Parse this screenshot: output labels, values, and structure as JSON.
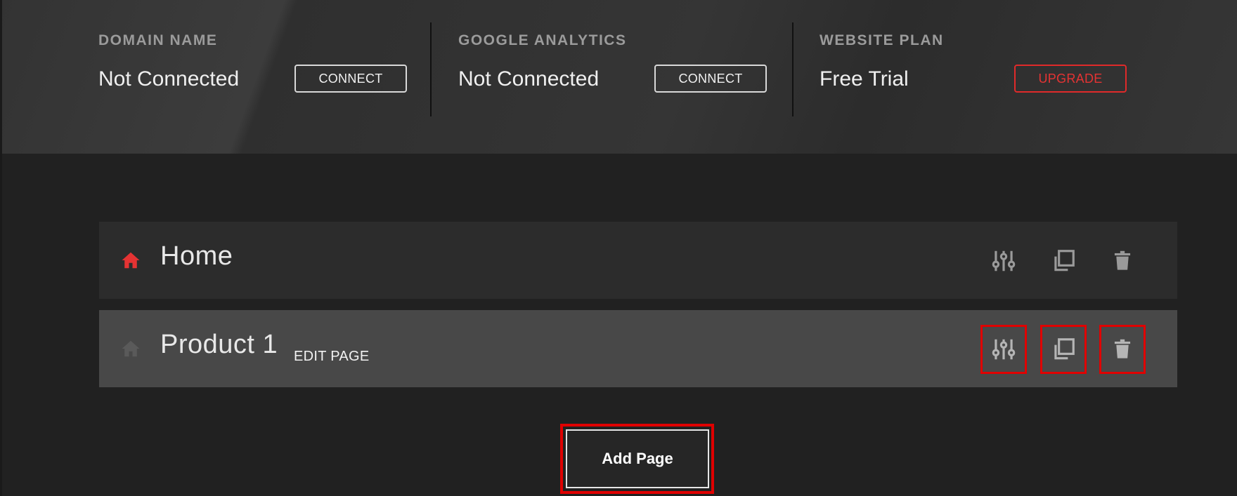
{
  "settings": {
    "domain": {
      "label": "DOMAIN NAME",
      "value": "Not Connected",
      "button": "CONNECT"
    },
    "analytics": {
      "label": "GOOGLE ANALYTICS",
      "value": "Not Connected",
      "button": "CONNECT"
    },
    "plan": {
      "label": "WEBSITE PLAN",
      "value": "Free Trial",
      "button": "UPGRADE"
    }
  },
  "pages": [
    {
      "title": "Home",
      "is_home": true,
      "edit_label": ""
    },
    {
      "title": "Product 1",
      "is_home": false,
      "edit_label": "EDIT PAGE"
    }
  ],
  "actions": {
    "add_page_label": "Add Page"
  },
  "colors": {
    "accent": "#e53333",
    "highlight": "#e00000",
    "home_icon_active": "#e53333",
    "home_icon_inactive": "#5a5a5a",
    "background": "#212121"
  },
  "icons": {
    "settings": "sliders-icon",
    "duplicate": "copy-icon",
    "delete": "trash-icon",
    "home": "house-icon"
  }
}
